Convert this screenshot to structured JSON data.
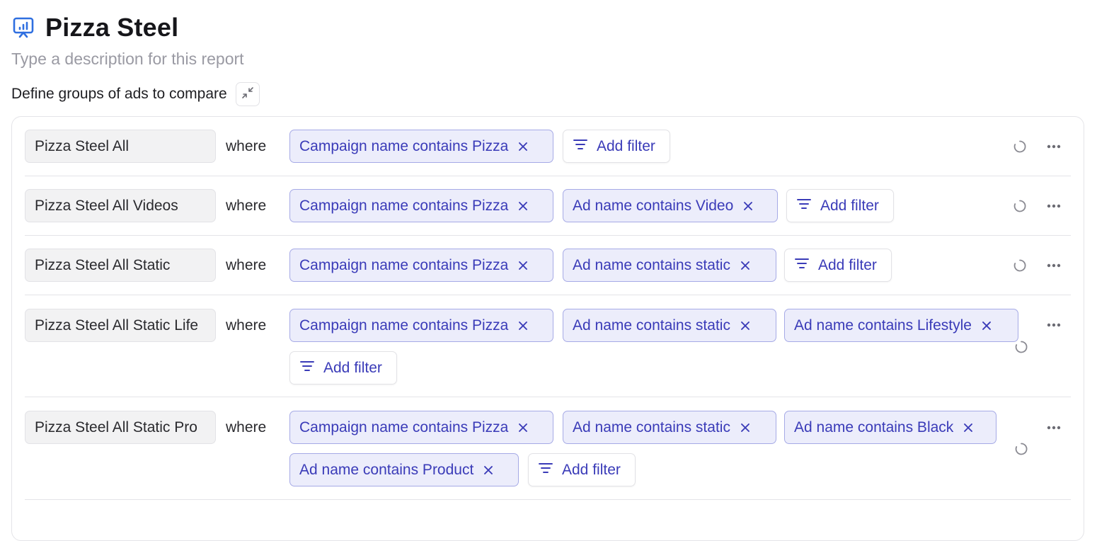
{
  "report": {
    "title": "Pizza Steel",
    "description_placeholder": "Type a description for this report"
  },
  "define_groups_label": "Define groups of ads to compare",
  "where_label": "where",
  "add_filter_label": "Add filter",
  "groups": [
    {
      "name": "Pizza Steel All",
      "filters": [
        "Campaign name contains Pizza"
      ]
    },
    {
      "name": "Pizza Steel All Videos",
      "filters": [
        "Campaign name contains Pizza",
        "Ad name contains Video"
      ]
    },
    {
      "name": "Pizza Steel All Static",
      "filters": [
        "Campaign name contains Pizza",
        "Ad name contains static"
      ]
    },
    {
      "name": "Pizza Steel All Static Life",
      "filters": [
        "Campaign name contains Pizza",
        "Ad name contains static",
        "Ad name contains Lifestyle"
      ]
    },
    {
      "name": "Pizza Steel All Static Pro",
      "filters": [
        "Campaign name contains Pizza",
        "Ad name contains static",
        "Ad name contains Black",
        "Ad name contains Product"
      ]
    }
  ],
  "colors": {
    "accent": "#3a3bb8",
    "chip_bg": "#ecedfb",
    "chip_border": "#a6aae6",
    "icon_blue": "#2f6fe0"
  },
  "icons": {
    "report": "chart-presentation-icon",
    "collapse": "collapse-arrows-icon",
    "remove": "close-icon",
    "filter": "filter-lines-icon",
    "reset": "refresh-icon",
    "more": "more-horizontal-icon"
  }
}
